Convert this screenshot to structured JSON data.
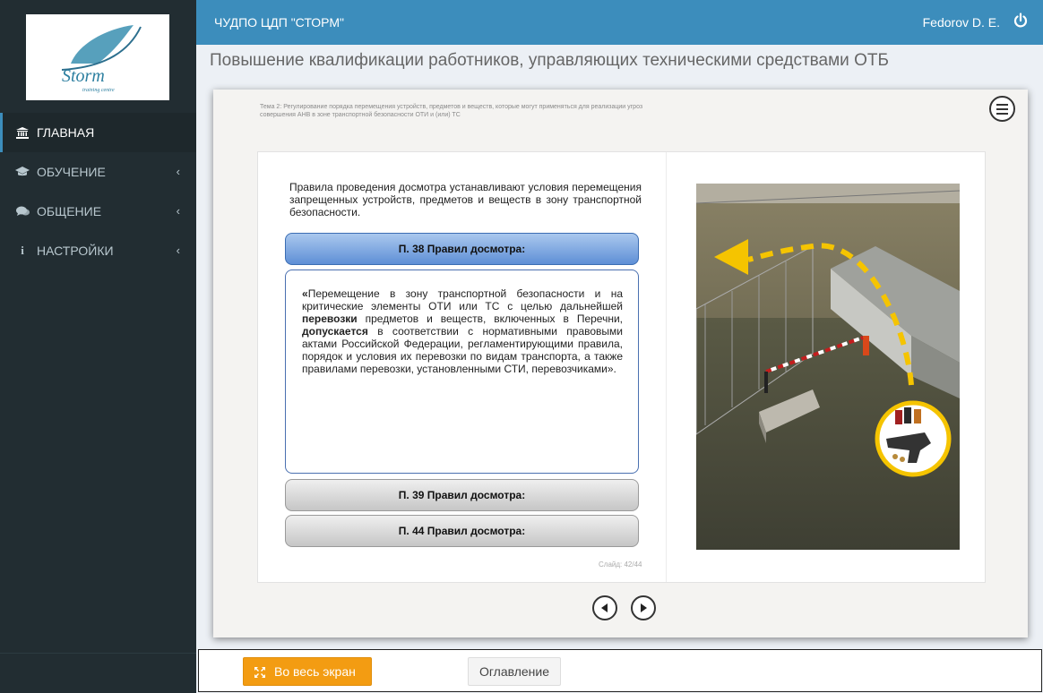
{
  "sidebar": {
    "logo_text": "Storm",
    "logo_subtext": "training centre",
    "items": [
      {
        "label": "ГЛАВНАЯ",
        "icon": "bank-icon"
      },
      {
        "label": "ОБУЧЕНИЕ",
        "icon": "graduation-cap-icon"
      },
      {
        "label": "ОБЩЕНИЕ",
        "icon": "comments-icon"
      },
      {
        "label": "НАСТРОЙКИ",
        "icon": "info-icon"
      }
    ],
    "chevron": "‹"
  },
  "header": {
    "brand": "ЧУДПО ЦДП \"СТОРМ\"",
    "user": "Fedorov D. E.",
    "power_icon": "power-icon"
  },
  "page_title": "Повышение квалификации работников, управляющих техническими средствами ОТБ",
  "slide": {
    "topic": "Тема 2: Регулирование порядка перемещения устройств, предметов и веществ, которые могут применяться для реализации угроз совершения АНВ в зоне транспортной безопасности ОТИ и (или) ТС",
    "intro": "Правила проведения досмотра устанавливают условия перемещения запрещенных устройств, предметов и веществ в зону транспортной безопасности.",
    "accordion": {
      "active_title": "П. 38 Правил досмотра:",
      "body": {
        "p1": "«",
        "p2": "Перемещение в зону транспортной безопасности и на критические элементы ОТИ или ТС с целью дальнейшей ",
        "p3": "перевозки",
        "p4": " предметов и веществ, включенных в Перечни, ",
        "p5": "допускается",
        "p6": " в соответствии с нормативными правовыми актами Российской Федерации, регламентирующими правила, порядок и условия их перевозки по видам транспорта, а также правилами перевозки, установленными СТИ, перевозчиками»."
      },
      "item2_title": "П. 39 Правил досмотра:",
      "item3_title": "П. 44 Правил досмотра:"
    },
    "counter": "Слайд:  42/44"
  },
  "bottom": {
    "fullscreen_label": "Во весь экран",
    "toc_label": "Оглавление"
  },
  "colors": {
    "sidebar": "#222d32",
    "header": "#3c8dbc",
    "accent_orange": "#f39c12",
    "arrow_yellow": "#f5c400"
  }
}
